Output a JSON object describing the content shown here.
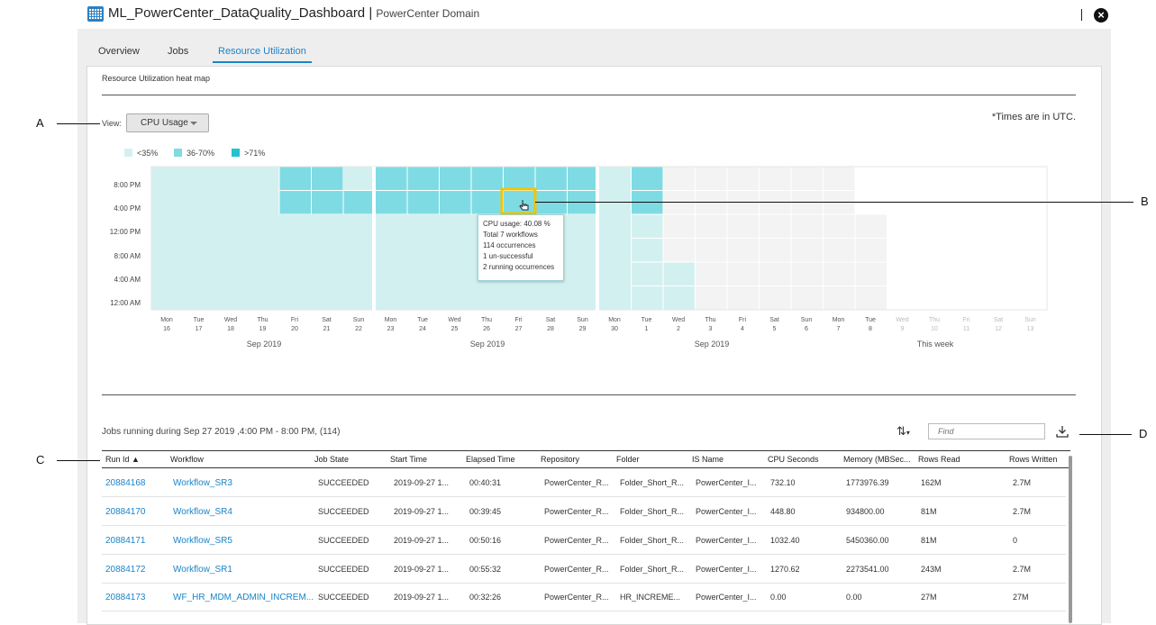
{
  "header": {
    "title": "ML_PowerCenter_DataQuality_Dashboard",
    "separator": "|",
    "subtitle": "PowerCenter Domain"
  },
  "tabs": [
    {
      "label": "Overview",
      "active": false
    },
    {
      "label": "Jobs",
      "active": false
    },
    {
      "label": "Resource Utilization",
      "active": true
    }
  ],
  "heatmap": {
    "section_title": "Resource Utilization heat map",
    "view_label": "View:",
    "view_value": "CPU Usage",
    "utc_note": "*Times are in UTC.",
    "legend": [
      {
        "label": "<35%",
        "color": "#d3f0f1"
      },
      {
        "label": "36-70%",
        "color": "#7fdbe3"
      },
      {
        "label": ">71%",
        "color": "#25c1cc"
      }
    ],
    "y_labels": [
      "8:00 PM",
      "4:00 PM",
      "12:00 PM",
      "8:00 AM",
      "4:00 AM",
      "12:00 AM"
    ],
    "days": [
      {
        "d": "Mon",
        "n": "16"
      },
      {
        "d": "Tue",
        "n": "17"
      },
      {
        "d": "Wed",
        "n": "18"
      },
      {
        "d": "Thu",
        "n": "19"
      },
      {
        "d": "Fri",
        "n": "20"
      },
      {
        "d": "Sat",
        "n": "21"
      },
      {
        "d": "Sun",
        "n": "22"
      },
      {
        "d": "Mon",
        "n": "23"
      },
      {
        "d": "Tue",
        "n": "24"
      },
      {
        "d": "Wed",
        "n": "25"
      },
      {
        "d": "Thu",
        "n": "26"
      },
      {
        "d": "Fri",
        "n": "27"
      },
      {
        "d": "Sat",
        "n": "28"
      },
      {
        "d": "Sun",
        "n": "29"
      },
      {
        "d": "Mon",
        "n": "30"
      },
      {
        "d": "Tue",
        "n": "1"
      },
      {
        "d": "Wed",
        "n": "2"
      },
      {
        "d": "Thu",
        "n": "3"
      },
      {
        "d": "Fri",
        "n": "4"
      },
      {
        "d": "Sat",
        "n": "5"
      },
      {
        "d": "Sun",
        "n": "6"
      },
      {
        "d": "Mon",
        "n": "7"
      },
      {
        "d": "Tue",
        "n": "8"
      },
      {
        "d": "Wed",
        "n": "9"
      },
      {
        "d": "Thu",
        "n": "10"
      },
      {
        "d": "Fri",
        "n": "11"
      },
      {
        "d": "Sat",
        "n": "12"
      },
      {
        "d": "Sun",
        "n": "13"
      }
    ],
    "week_labels": [
      "Sep 2019",
      "Sep 2019",
      "Sep 2019",
      "This week"
    ],
    "tooltip": [
      "CPU usage: 40.08 %",
      "Total 7 workflows",
      "114 occurrences",
      "1 un-successful",
      "2 running occurrences"
    ]
  },
  "callouts": [
    "A",
    "B",
    "C",
    "D"
  ],
  "jobs": {
    "title": "Jobs running during Sep 27 2019 ,4:00 PM - 8:00 PM, (114)",
    "find_placeholder": "Find",
    "columns": [
      "Run Id ▲",
      "Workflow",
      "Job State",
      "Start Time",
      "Elapsed Time",
      "Repository",
      "Folder",
      "IS Name",
      "CPU Seconds",
      "Memory (MBSec...",
      "Rows Read",
      "Rows Written"
    ],
    "rows": [
      [
        "20884168",
        "Workflow_SR3",
        "SUCCEEDED",
        "2019-09-27 1...",
        "00:40:31",
        "PowerCenter_R...",
        "Folder_Short_R...",
        "PowerCenter_I...",
        "732.10",
        "1773976.39",
        "162M",
        "2.7M"
      ],
      [
        "20884170",
        "Workflow_SR4",
        "SUCCEEDED",
        "2019-09-27 1...",
        "00:39:45",
        "PowerCenter_R...",
        "Folder_Short_R...",
        "PowerCenter_I...",
        "448.80",
        "934800.00",
        "81M",
        "2.7M"
      ],
      [
        "20884171",
        "Workflow_SR5",
        "SUCCEEDED",
        "2019-09-27 1...",
        "00:50:16",
        "PowerCenter_R...",
        "Folder_Short_R...",
        "PowerCenter_I...",
        "1032.40",
        "5450360.00",
        "81M",
        "0"
      ],
      [
        "20884172",
        "Workflow_SR1",
        "SUCCEEDED",
        "2019-09-27 1...",
        "00:55:32",
        "PowerCenter_R...",
        "Folder_Short_R...",
        "PowerCenter_I...",
        "1270.62",
        "2273541.00",
        "243M",
        "2.7M"
      ],
      [
        "20884173",
        "WF_HR_MDM_ADMIN_INCREM...",
        "SUCCEEDED",
        "2019-09-27 1...",
        "00:32:26",
        "PowerCenter_R...",
        "HR_INCREME...",
        "PowerCenter_I...",
        "0.00",
        "0.00",
        "27M",
        "27M"
      ]
    ]
  }
}
